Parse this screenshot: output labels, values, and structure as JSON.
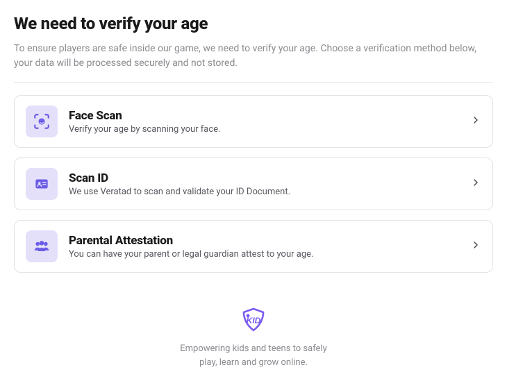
{
  "header": {
    "title": "We need to verify your age",
    "subtitle": "To ensure players are safe inside our game, we need to verify your age. Choose a verification method below, your data will be processed securely and not stored."
  },
  "options": [
    {
      "icon": "face-scan-icon",
      "title": "Face Scan",
      "description": "Verify your age by scanning your face."
    },
    {
      "icon": "scan-id-icon",
      "title": "Scan ID",
      "description": "We use Veratad to scan and validate your ID Document."
    },
    {
      "icon": "parental-icon",
      "title": "Parental Attestation",
      "description": "You can have your parent or legal guardian attest to your age."
    }
  ],
  "footer": {
    "line1": "Empowering kids and teens to safely",
    "line2": "play, learn and grow online."
  }
}
